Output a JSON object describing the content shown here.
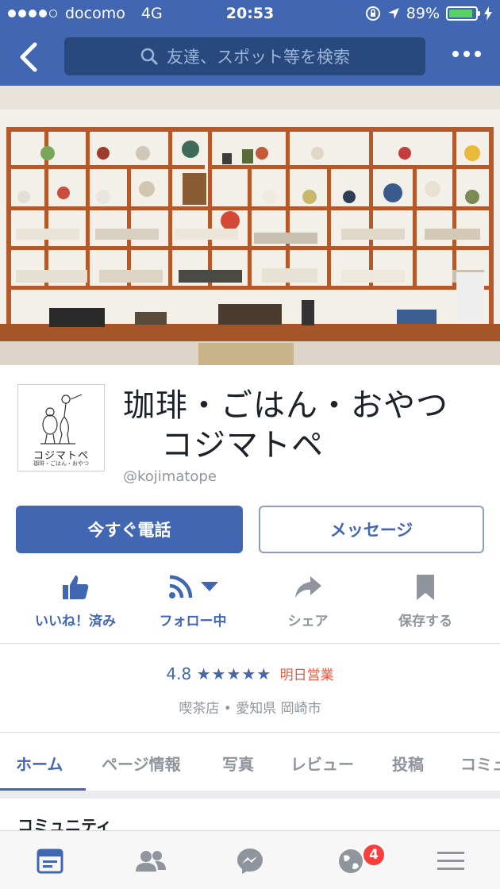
{
  "status_bar": {
    "carrier": "docomo",
    "network": "4G",
    "time": "20:53",
    "battery": "89%"
  },
  "nav": {
    "search_placeholder": "友達、スポット等を検索"
  },
  "page": {
    "name_line1": "珈琲・ごはん・おやつ",
    "name_line2": "コジマトペ",
    "handle": "@kojimatope",
    "logo_text": "コジマトペ",
    "logo_subtext": "珈琲・ごはん・おやつ"
  },
  "buttons": {
    "call": "今すぐ電話",
    "message": "メッセージ"
  },
  "actions": {
    "like": "いいね！済み",
    "follow": "フォロー中",
    "share": "シェア",
    "save": "保存する"
  },
  "info": {
    "rating": "4.8",
    "stars": "★★★★★",
    "open_status": "明日営業",
    "category": "喫茶店",
    "location": "愛知県 岡崎市"
  },
  "tabs": [
    "ホーム",
    "ページ情報",
    "写真",
    "レビュー",
    "投稿",
    "コミュ"
  ],
  "section": {
    "title": "コミュニティ"
  },
  "bottom_nav": {
    "notification_count": "4",
    "icons": [
      "news-feed-icon",
      "friends-icon",
      "messenger-icon",
      "globe-icon",
      "menu-icon"
    ]
  },
  "colors": {
    "brand": "#4267b2",
    "brand_dark": "#29487d",
    "badge": "#fa3e3e",
    "open_status": "#e9573f",
    "muted": "#90949c"
  }
}
